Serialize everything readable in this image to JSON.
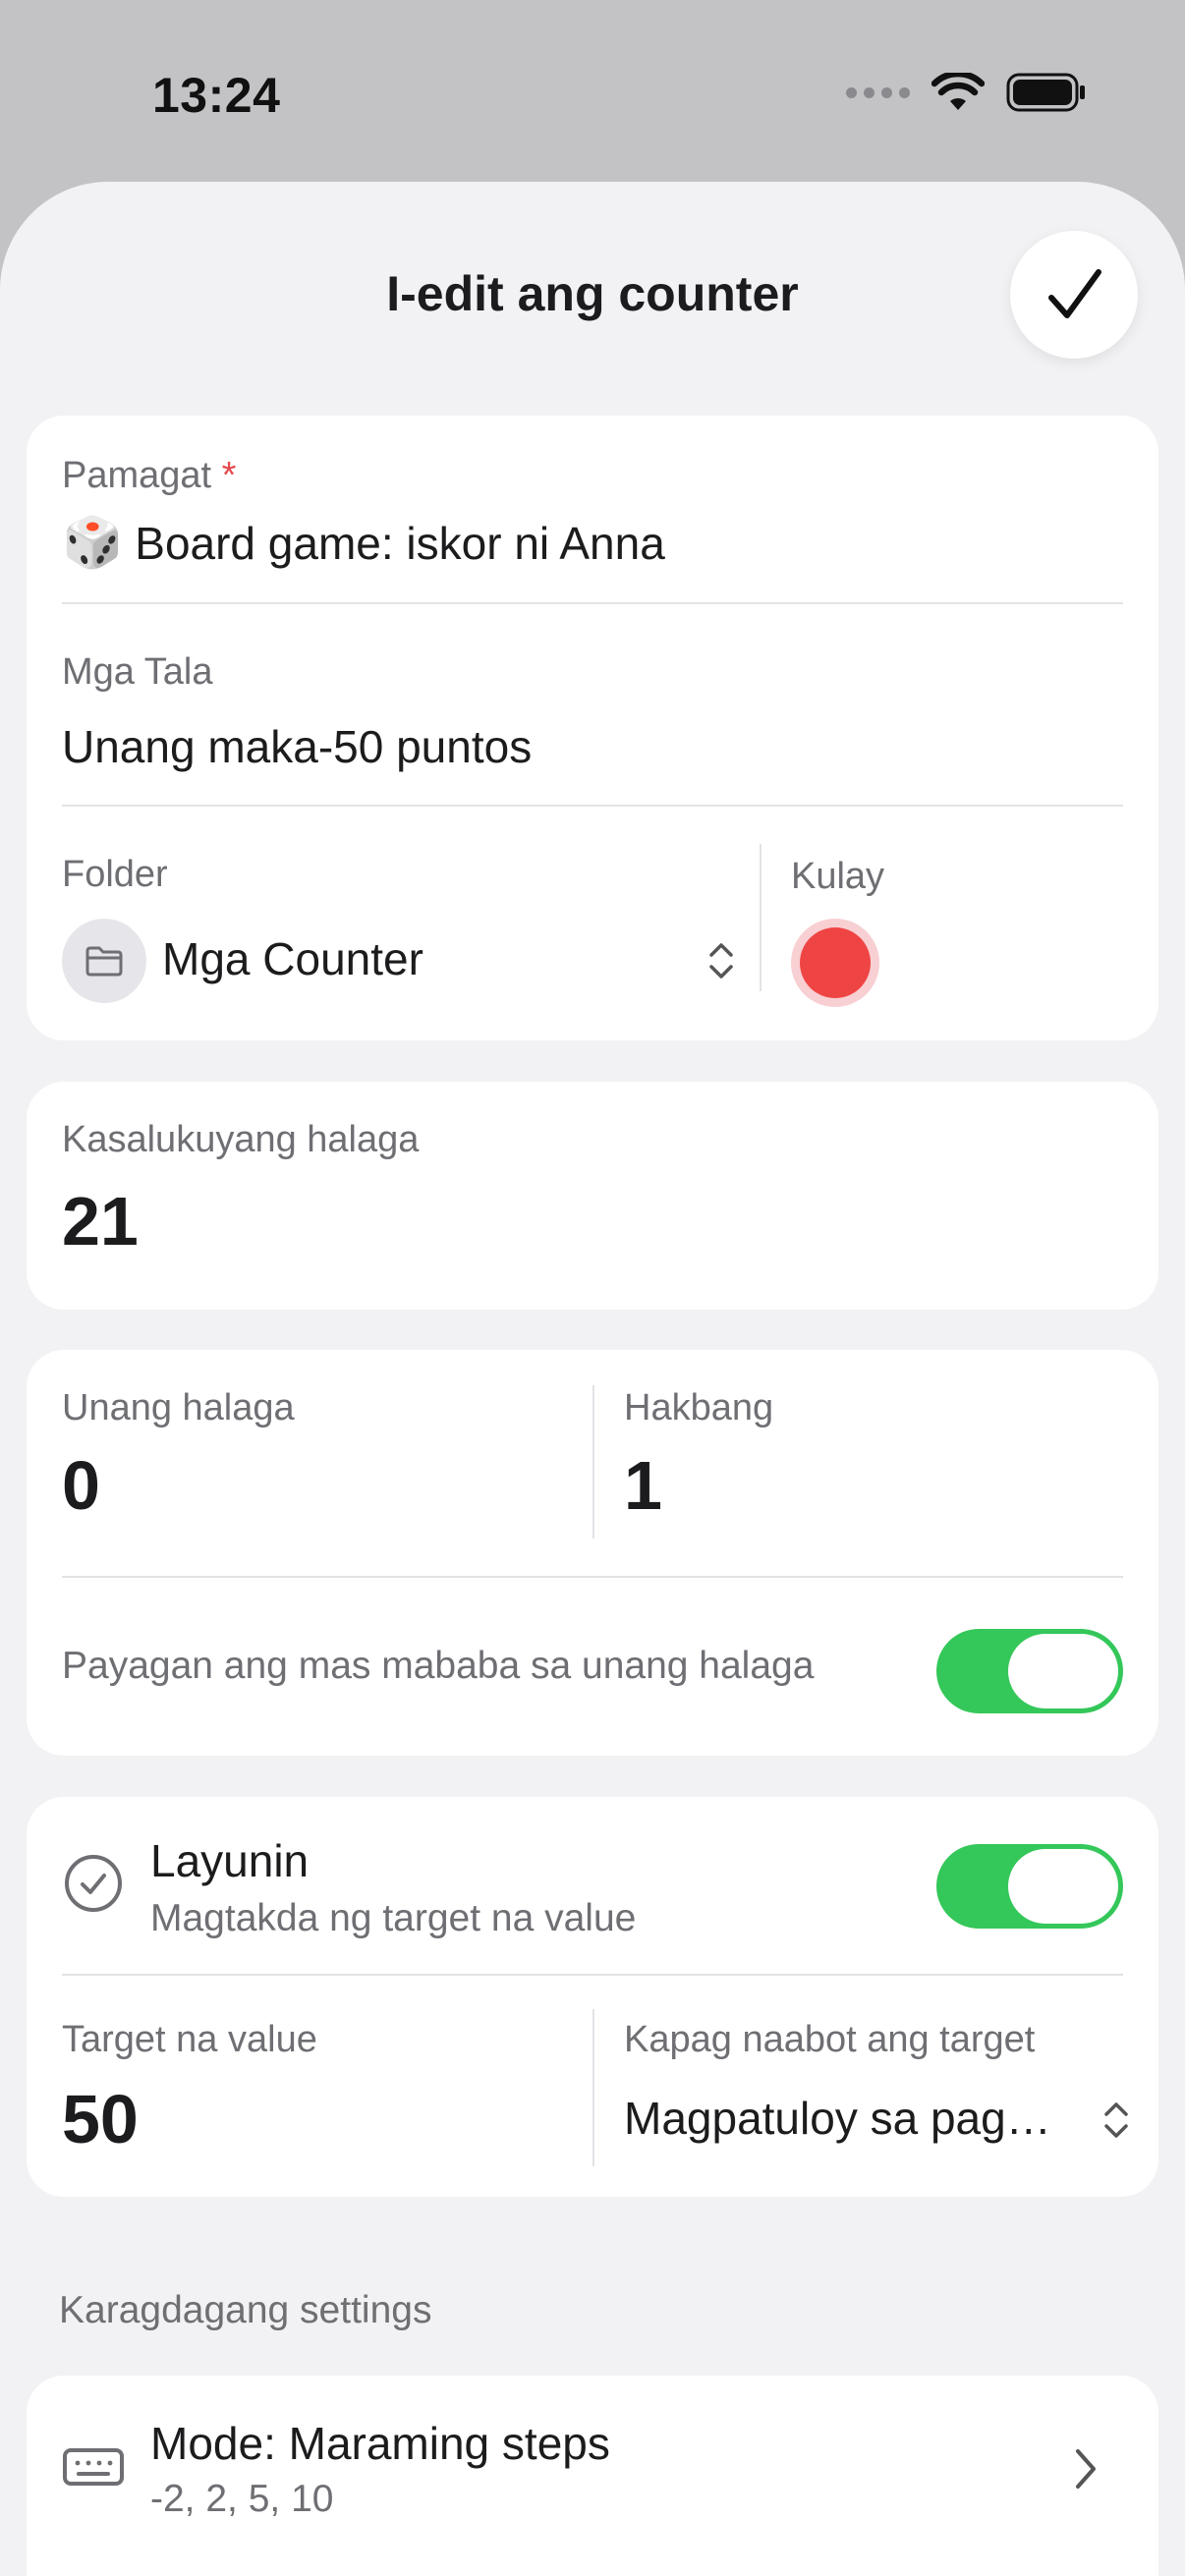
{
  "status_bar": {
    "time": "13:24"
  },
  "header": {
    "title": "I-edit ang counter"
  },
  "details": {
    "title_label": "Pamagat",
    "required_mark": "*",
    "title_emoji": "🎲",
    "title_value": "Board game: iskor ni Anna",
    "notes_label": "Mga Tala",
    "notes_value": "Unang maka-50 puntos",
    "folder_label": "Folder",
    "folder_value": "Mga Counter",
    "color_label": "Kulay",
    "color_value": "#ef4444"
  },
  "current": {
    "label": "Kasalukuyang halaga",
    "value": "21"
  },
  "values": {
    "initial_label": "Unang halaga",
    "initial_value": "0",
    "step_label": "Hakbang",
    "step_value": "1",
    "allow_below_label": "Payagan ang mas mababa sa unang halaga",
    "allow_below_on": true
  },
  "goal": {
    "title": "Layunin",
    "subtitle": "Magtakda ng target na value",
    "enabled": true,
    "target_label": "Target na value",
    "target_value": "50",
    "on_reach_label": "Kapag naabot ang target",
    "on_reach_value": "Magpatuloy sa pag…"
  },
  "more": {
    "section_label": "Karagdagang settings",
    "mode_title": "Mode: Maraming steps",
    "mode_subtitle": "-2, 2, 5, 10"
  },
  "colors": {
    "toggle_on": "#34c759",
    "accent_red": "#ef4444",
    "required": "#e5484d"
  }
}
